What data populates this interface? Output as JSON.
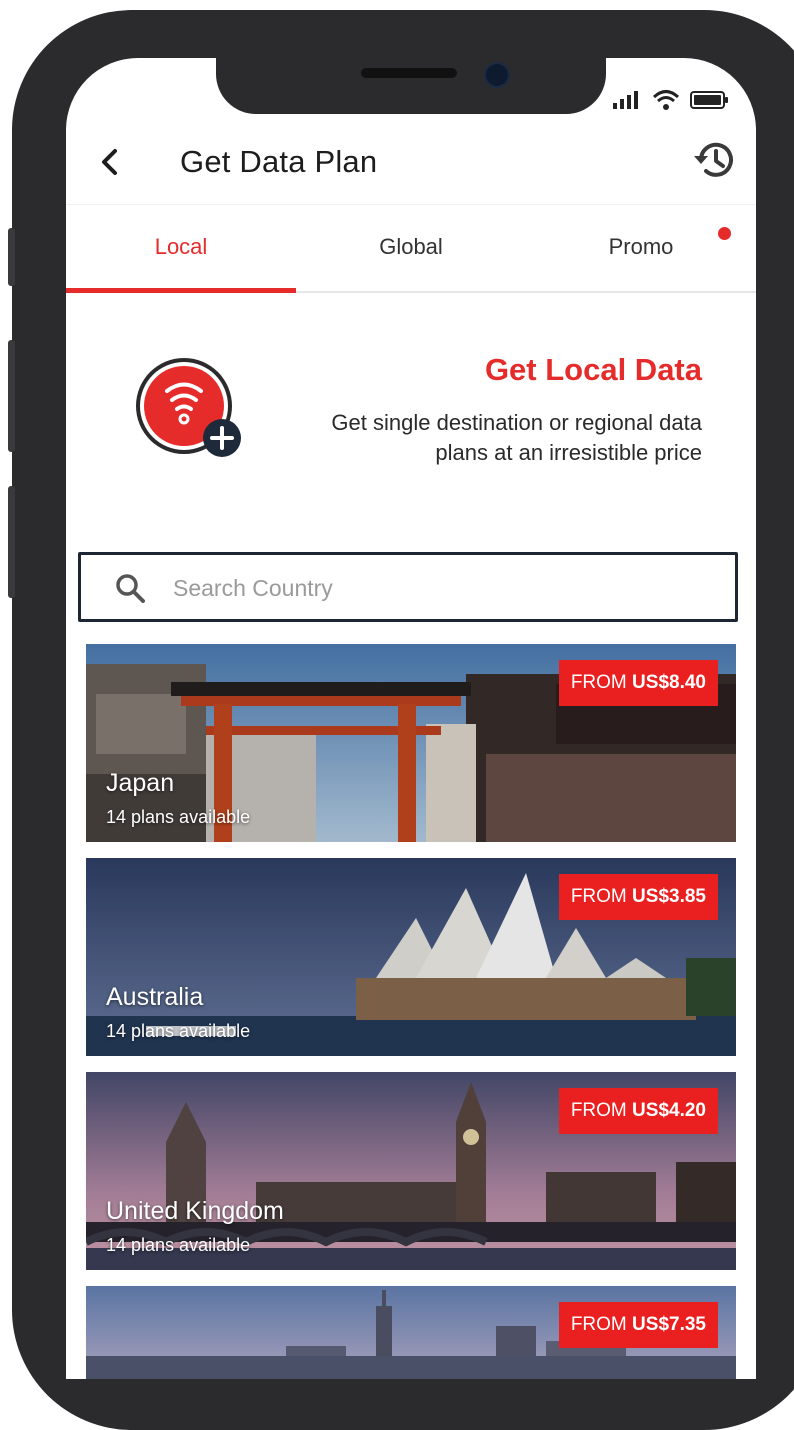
{
  "app": {
    "title": "Get Data Plan"
  },
  "colors": {
    "accent": "#e62b2b",
    "price_badge": "#ea2020",
    "frame": "#2b2b2d"
  },
  "icons": {
    "back": "chevron-left-icon",
    "history": "history-icon",
    "search": "search-icon",
    "hero": "wifi-plus-icon"
  },
  "tabs": [
    {
      "label": "Local",
      "active": true
    },
    {
      "label": "Global",
      "active": false
    },
    {
      "label": "Promo",
      "active": false,
      "has_notification": true
    }
  ],
  "hero": {
    "title": "Get Local Data",
    "description": "Get single destination or regional data plans at an irresistible price"
  },
  "search": {
    "placeholder": "Search Country",
    "value": ""
  },
  "destinations": [
    {
      "country": "Japan",
      "plans": "14 plans available",
      "price_prefix": "FROM",
      "price": "US$8.40"
    },
    {
      "country": "Australia",
      "plans": "14 plans available",
      "price_prefix": "FROM",
      "price": "US$3.85"
    },
    {
      "country": "United Kingdom",
      "plans": "14 plans available",
      "price_prefix": "FROM",
      "price": "US$4.20"
    },
    {
      "country": "",
      "plans": "",
      "price_prefix": "FROM",
      "price": "US$7.35"
    }
  ]
}
